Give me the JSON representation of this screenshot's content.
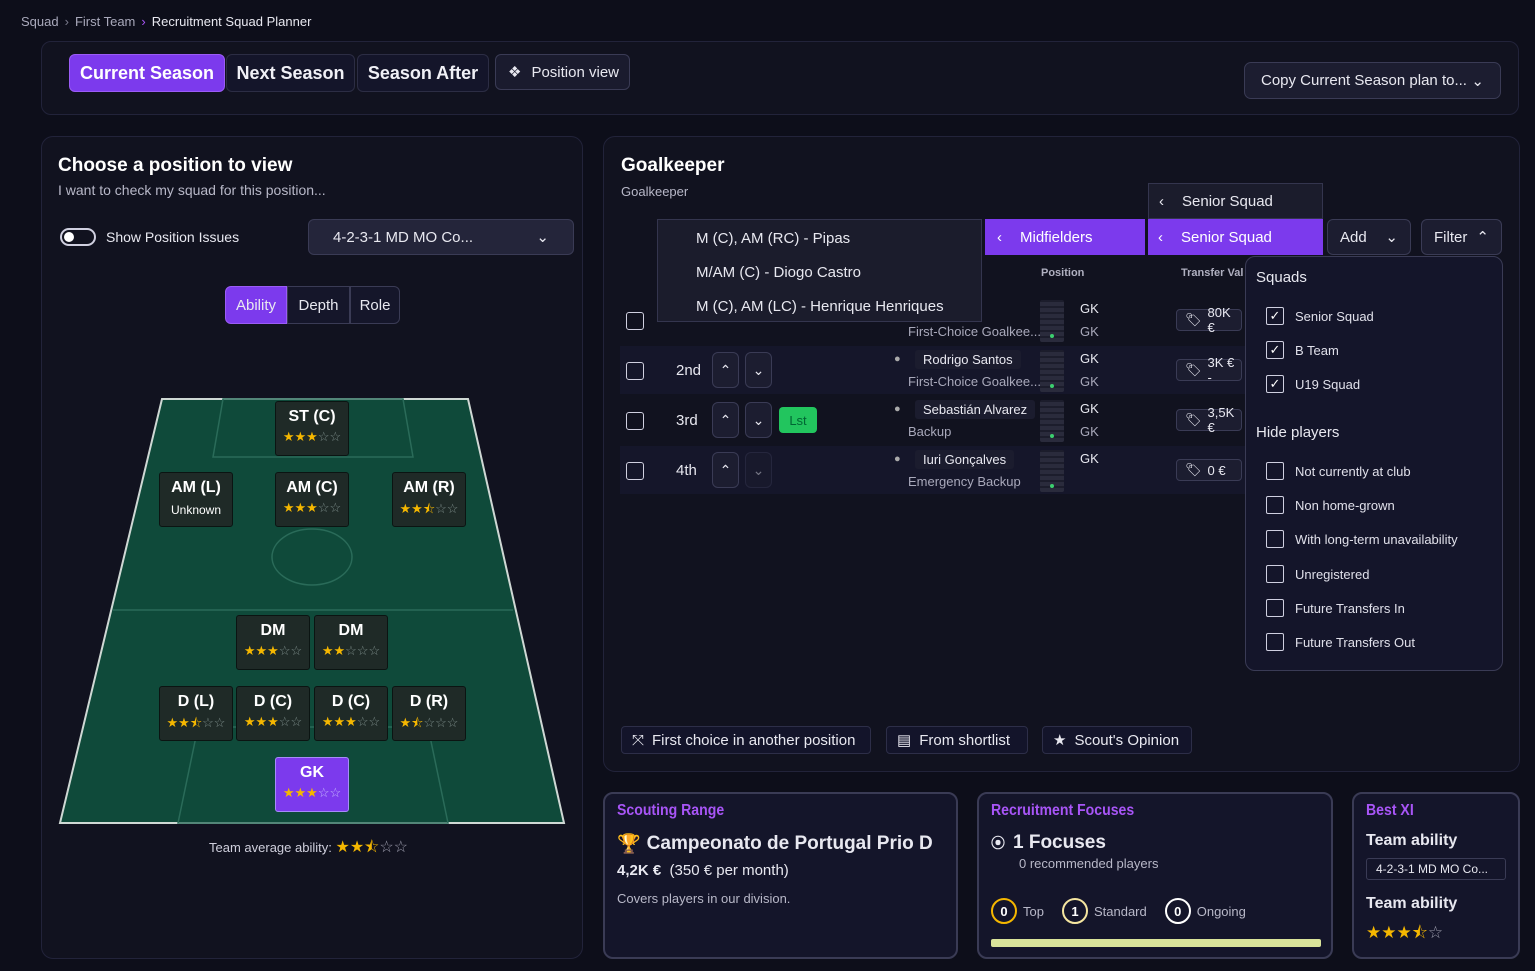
{
  "breadcrumb": {
    "items": [
      "Squad",
      "First Team",
      "Recruitment Squad Planner"
    ]
  },
  "season_tabs": [
    "Current Season",
    "Next Season",
    "Season After"
  ],
  "position_view_label": "Position view",
  "copy_plan_label": "Copy Current Season plan to...",
  "left": {
    "title": "Choose a position to view",
    "subtitle": "I want to check my squad for this position...",
    "toggle_label": "Show Position Issues",
    "formation": "4-2-3-1 MD MO Co...",
    "view_tabs": [
      "Ability",
      "Depth",
      "Role"
    ],
    "positions": {
      "st": {
        "label": "ST (C)",
        "stars": "★★★",
        "empty": "☆☆"
      },
      "aml": {
        "label": "AM (L)",
        "note": "Unknown"
      },
      "amc": {
        "label": "AM (C)",
        "stars": "★★★",
        "empty": "☆☆"
      },
      "amr": {
        "label": "AM (R)",
        "stars": "★★⯪",
        "empty": "☆☆"
      },
      "dm1": {
        "label": "DM",
        "stars": "★★★",
        "empty": "☆☆"
      },
      "dm2": {
        "label": "DM",
        "stars": "★★",
        "empty": "☆☆☆"
      },
      "dl": {
        "label": "D (L)",
        "stars": "★★⯪",
        "empty": "☆☆"
      },
      "dc1": {
        "label": "D (C)",
        "stars": "★★★",
        "empty": "☆☆"
      },
      "dc2": {
        "label": "D (C)",
        "stars": "★★★",
        "empty": "☆☆"
      },
      "dr": {
        "label": "D (R)",
        "stars": "★⯪",
        "empty": "☆☆☆"
      },
      "gk": {
        "label": "GK",
        "stars": "★★★",
        "empty": "☆☆"
      }
    },
    "team_avg_label": "Team average ability:",
    "team_avg_stars": "★★⯪",
    "team_avg_empty": "☆☆"
  },
  "right": {
    "title": "Goalkeeper",
    "subtitle": "Goalkeeper",
    "menu_items": [
      "M (C), AM (RC) - Pipas",
      "M/AM (C) - Diogo Castro",
      "M (C), AM (LC) - Henrique Henriques"
    ],
    "midfielders_label": "Midfielders",
    "senior_squad_top": "Senior Squad",
    "senior_squad_btn": "Senior Squad",
    "add_label": "Add",
    "filter_label": "Filter",
    "col_position": "Position",
    "col_transfer": "Transfer Val",
    "rows": [
      {
        "rank": "",
        "name": "",
        "role": "First-Choice Goalkee...",
        "pos1": "GK",
        "pos2": "GK",
        "value": "80K €",
        "name_partial": "o"
      },
      {
        "rank": "2nd",
        "name": "Rodrigo Santos",
        "role": "First-Choice Goalkee...",
        "pos1": "GK",
        "pos2": "GK",
        "value": "3K € -"
      },
      {
        "rank": "3rd",
        "name": "Sebastián Alvarez",
        "role": "Backup",
        "pos1": "GK",
        "pos2": "GK",
        "value": "3,5K €",
        "badge": "Lst"
      },
      {
        "rank": "4th",
        "name": "Iuri Gonçalves",
        "role": "Emergency Backup",
        "pos1": "GK",
        "pos2": "",
        "value": "0 €"
      }
    ],
    "bottom_buttons": [
      "First choice in another position",
      "From shortlist",
      "Scout's Opinion"
    ]
  },
  "filter": {
    "squads_title": "Squads",
    "squads": [
      {
        "label": "Senior Squad",
        "checked": true
      },
      {
        "label": "B Team",
        "checked": true
      },
      {
        "label": "U19 Squad",
        "checked": true
      }
    ],
    "hide_title": "Hide players",
    "hide": [
      "Not currently at club",
      "Non home-grown",
      "With long-term unavailability",
      "Unregistered",
      "Future Transfers In",
      "Future Transfers Out"
    ]
  },
  "scouting": {
    "title": "Scouting Range",
    "league": "Campeonato de Portugal Prio D",
    "amount": "4,2K €",
    "per_month": "(350 € per month)",
    "desc": "Covers players in our division."
  },
  "focuses": {
    "title": "Recruitment Focuses",
    "count": "1 Focuses",
    "recommended": "0 recommended players",
    "top_n": "0",
    "top_label": "Top",
    "std_n": "1",
    "std_label": "Standard",
    "ong_n": "0",
    "ong_label": "Ongoing"
  },
  "bestxi": {
    "title": "Best XI",
    "ability_label": "Team ability",
    "formation": "4-2-3-1 MD MO Co...",
    "ability_label2": "Team ability",
    "stars": "★★★⯪",
    "empty": "☆"
  },
  "colors": {
    "accent": "#7c3aed",
    "pitch": "#0f4a3a",
    "star": "#f5b700",
    "green_badge": "#22c55e"
  }
}
